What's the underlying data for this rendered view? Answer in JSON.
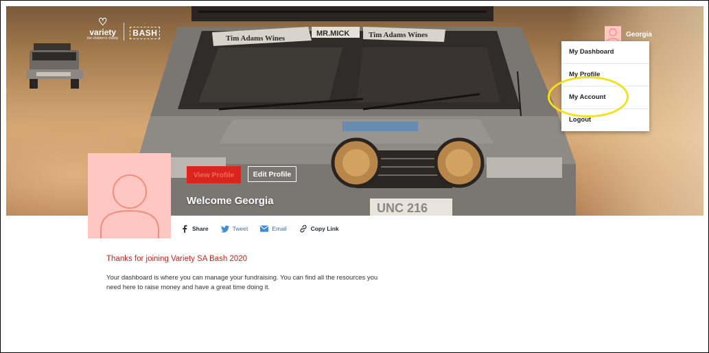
{
  "header": {
    "logo_variety": "variety",
    "logo_variety_tag": "the children's charity",
    "logo_bash": "BASH",
    "user_name": "Georgia"
  },
  "user_menu": {
    "items": [
      {
        "label": "My Dashboard"
      },
      {
        "label": "My Profile"
      },
      {
        "label": "My Account"
      },
      {
        "label": "Logout"
      }
    ]
  },
  "hero": {
    "car_banner_left": "Tim Adams Wines",
    "car_banner_mid": "MR.MICK",
    "car_banner_right": "Tim Adams Wines",
    "plate": "UNC 216"
  },
  "profile": {
    "view_profile_label": "View Profile",
    "edit_profile_label": "Edit Profile",
    "welcome_text": "Welcome Georgia"
  },
  "share": {
    "share_label": "Share",
    "tweet_label": "Tweet",
    "email_label": "Email",
    "copy_link_label": "Copy Link"
  },
  "content": {
    "thanks_title": "Thanks for joining Variety SA Bash 2020",
    "intro_text": "Your dashboard is where you can manage your fundraising. You can find all the resources you need here to raise money and have a great time doing it."
  },
  "colors": {
    "accent_red": "#d9251d",
    "avatar_pink": "#ffc7c2",
    "highlight_yellow": "#f2e21a"
  }
}
